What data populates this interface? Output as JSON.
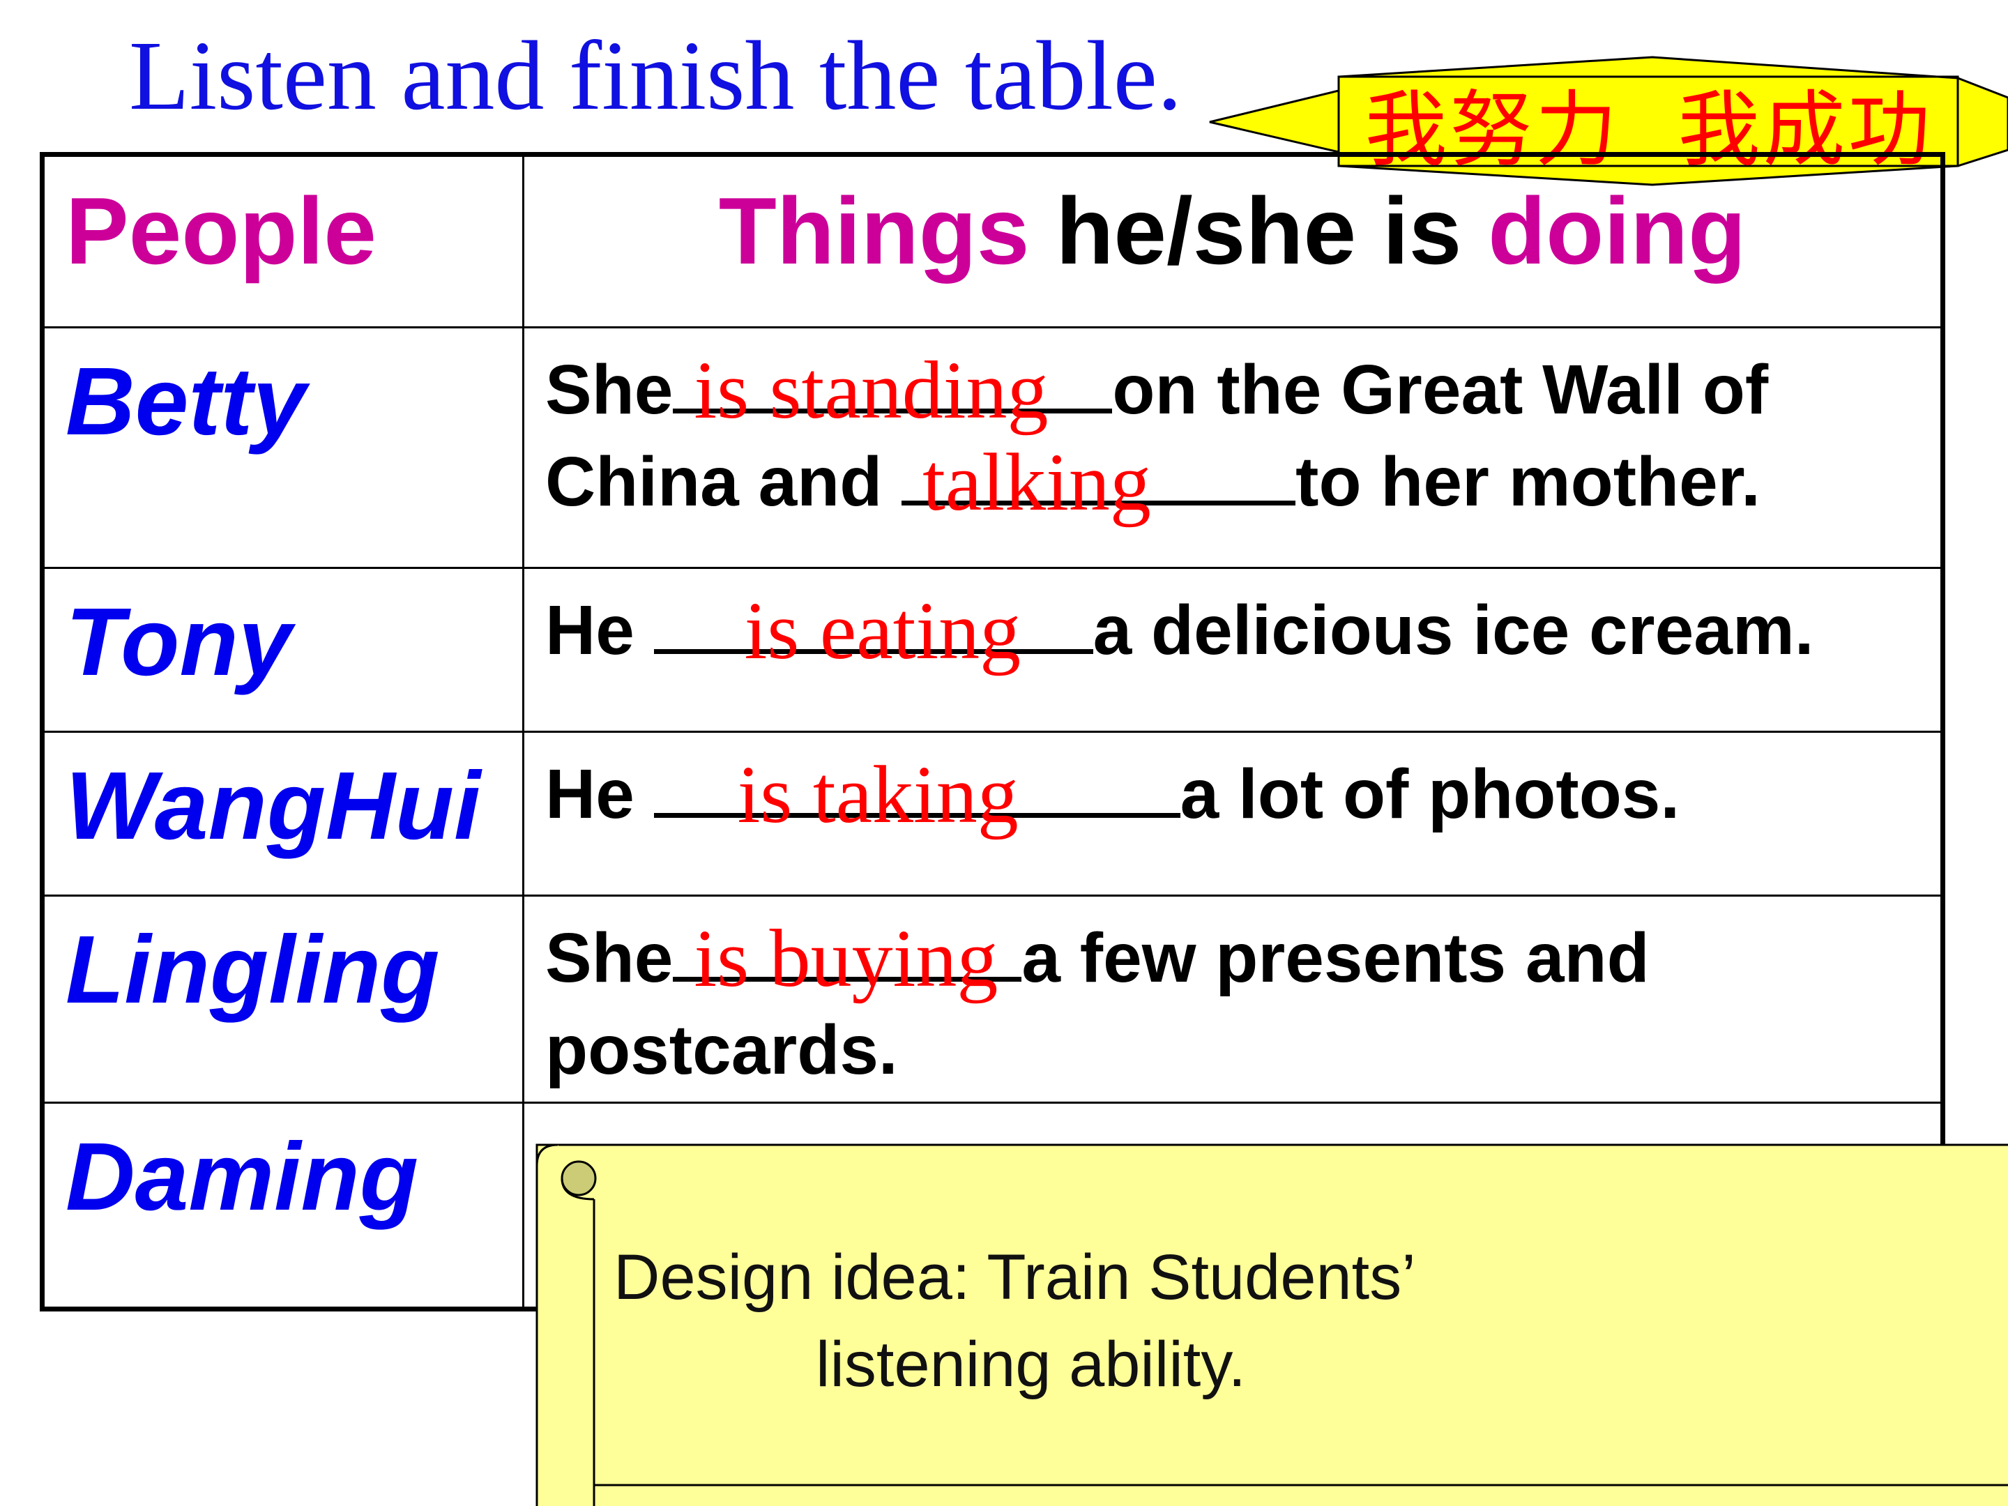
{
  "title": "Listen and finish the table.",
  "banner": {
    "text": "我努力  我成功",
    "fill": "#ffff00",
    "text_color": "#ff0000"
  },
  "table": {
    "header": {
      "people": "People",
      "things_part1": "Things",
      "things_part2": " he/she is ",
      "things_part3": "doing"
    },
    "rows": [
      {
        "name": "Betty",
        "line1_a": "She",
        "blank1": "is standing",
        "line1_b": "on the Great Wall of",
        "line2_a": "China and ",
        "blank2": "talking",
        "line2_b": "to her mother."
      },
      {
        "name": "Tony",
        "a": "He ",
        "blank": "is eating",
        "b": "a delicious ice cream."
      },
      {
        "name": "WangHui",
        "a": "He ",
        "blank": "is taking",
        "b": "a lot of photos."
      },
      {
        "name": "Lingling",
        "line1_a": "She",
        "blank1": "is buying",
        "line1_b": "a few presents and",
        "line2": "postcards."
      },
      {
        "name": "Daming"
      }
    ]
  },
  "note": {
    "line1": "Design idea: Train Students’",
    "line2": "listening  ability.",
    "fill": "#ffff99"
  },
  "colors": {
    "title": "#1010e0",
    "names": "#0000ee",
    "header_accent": "#cc0099",
    "answers": "#ff0000"
  }
}
